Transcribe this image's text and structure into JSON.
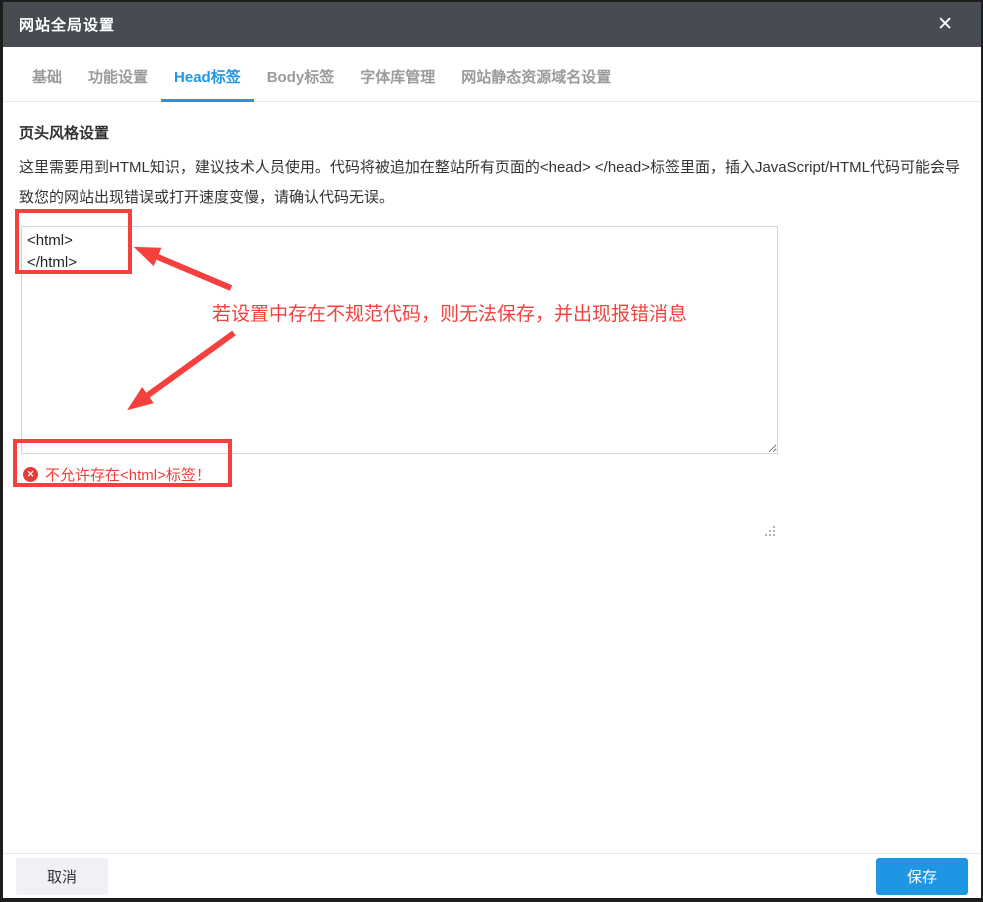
{
  "dialog": {
    "title": "网站全局设置",
    "close_icon": "✕"
  },
  "tabs": [
    {
      "label": "基础",
      "active": false
    },
    {
      "label": "功能设置",
      "active": false
    },
    {
      "label": "Head标签",
      "active": true
    },
    {
      "label": "Body标签",
      "active": false
    },
    {
      "label": "字体库管理",
      "active": false
    },
    {
      "label": "网站静态资源域名设置",
      "active": false
    }
  ],
  "section": {
    "title": "页头风格设置",
    "description": "这里需要用到HTML知识，建议技术人员使用。代码将被追加在整站所有页面的<head> </head>标签里面，插入JavaScript/HTML代码可能会导致您的网站出现错误或打开速度变慢，请确认代码无误。"
  },
  "editor": {
    "value": "<html>\n</html>"
  },
  "error": {
    "icon": "✕",
    "message": "不允许存在<html>标签！"
  },
  "annotation": {
    "note": "若设置中存在不规范代码，则无法保存，并出现报错消息"
  },
  "footer": {
    "cancel_label": "取消",
    "save_label": "保存"
  },
  "colors": {
    "header_bg": "#474c52",
    "accent_blue": "#2196e8",
    "save_blue": "#1f96e4",
    "annotation_red": "#f5413d",
    "error_red": "#f23c3c"
  }
}
